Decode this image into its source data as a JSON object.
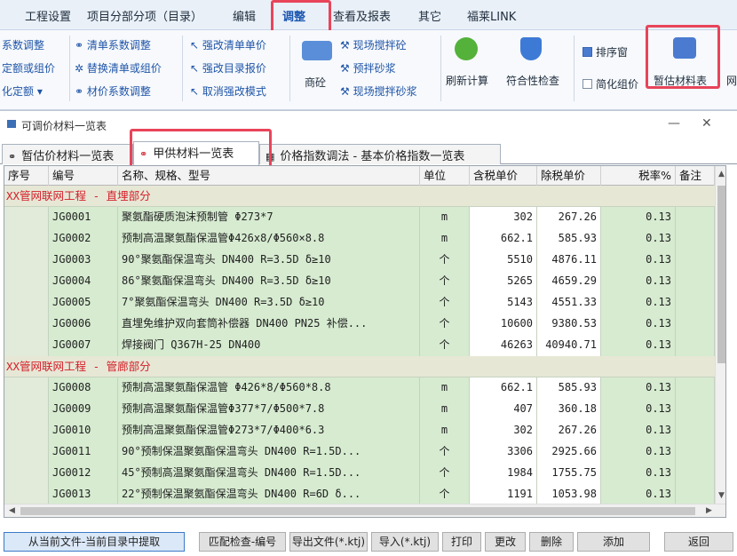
{
  "menu": {
    "items": [
      "工程设置",
      "项目分部分项（目录）",
      "编辑",
      "调整",
      "查看及报表",
      "其它",
      "福莱LINK"
    ]
  },
  "ribbon": {
    "left_col": [
      "系数调整",
      "定额或组价",
      "化定额 ▾"
    ],
    "col2": [
      "清单系数调整",
      "替换清单或组价",
      "材价系数调整"
    ],
    "col3": [
      "强改清单单价",
      "强改目录报价",
      "取消强改模式"
    ],
    "big1_label": "商砼",
    "col4": [
      "现场搅拌砼",
      "预拌砂浆",
      "现场搅拌砂浆"
    ],
    "refresh_label": "刷新计算",
    "check_label": "符合性检查",
    "col6": [
      "排序窗",
      "简化组价"
    ],
    "estimate_label": "暂估材料表",
    "cut_label": "网"
  },
  "dialog": {
    "title": "可调价材料一览表",
    "tabs": [
      "暂估价材料一览表",
      "甲供材料一览表",
      "价格指数调法 - 基本价格指数一览表"
    ]
  },
  "table": {
    "headers": [
      "序号",
      "编号",
      "名称、规格、型号",
      "单位",
      "含税单价",
      "除税单价",
      "税率%",
      "备注"
    ],
    "groups": [
      {
        "title": "XX管网联网工程 - 直埋部分",
        "rows": [
          {
            "code": "JG0001",
            "name": "聚氨酯硬质泡沫预制管 Φ273*7",
            "unit": "m",
            "tax": "302",
            "ntax": "267.26",
            "rate": "0.13"
          },
          {
            "code": "JG0002",
            "name": "预制高温聚氨酯保温管Φ426x8/Φ560×8.8",
            "unit": "m",
            "tax": "662.1",
            "ntax": "585.93",
            "rate": "0.13"
          },
          {
            "code": "JG0003",
            "name": "90°聚氨酯保温弯头 DN400 R=3.5D δ≥10",
            "unit": "个",
            "tax": "5510",
            "ntax": "4876.11",
            "rate": "0.13"
          },
          {
            "code": "JG0004",
            "name": "86°聚氨酯保温弯头 DN400 R=3.5D δ≥10",
            "unit": "个",
            "tax": "5265",
            "ntax": "4659.29",
            "rate": "0.13"
          },
          {
            "code": "JG0005",
            "name": "7°聚氨酯保温弯头 DN400 R=3.5D δ≥10",
            "unit": "个",
            "tax": "5143",
            "ntax": "4551.33",
            "rate": "0.13"
          },
          {
            "code": "JG0006",
            "name": "直埋免维护双向套筒补偿器 DN400 PN25 补偿...",
            "unit": "个",
            "tax": "10600",
            "ntax": "9380.53",
            "rate": "0.13"
          },
          {
            "code": "JG0007",
            "name": "焊接阀门 Q367H-25 DN400",
            "unit": "个",
            "tax": "46263",
            "ntax": "40940.71",
            "rate": "0.13"
          }
        ]
      },
      {
        "title": "XX管网联网工程 - 管廊部分",
        "rows": [
          {
            "code": "JG0008",
            "name": "预制高温聚氨酯保温管 Φ426*8/Φ560*8.8",
            "unit": "m",
            "tax": "662.1",
            "ntax": "585.93",
            "rate": "0.13"
          },
          {
            "code": "JG0009",
            "name": "预制高温聚氨酯保温管Φ377*7/Φ500*7.8",
            "unit": "m",
            "tax": "407",
            "ntax": "360.18",
            "rate": "0.13"
          },
          {
            "code": "JG0010",
            "name": "预制高温聚氨酯保温管Φ273*7/Φ400*6.3",
            "unit": "m",
            "tax": "302",
            "ntax": "267.26",
            "rate": "0.13"
          },
          {
            "code": "JG0011",
            "name": "90°预制保温聚氨酯保温弯头 DN400 R=1.5D...",
            "unit": "个",
            "tax": "3306",
            "ntax": "2925.66",
            "rate": "0.13"
          },
          {
            "code": "JG0012",
            "name": "45°预制高温聚氨酯保温弯头 DN400 R=1.5D...",
            "unit": "个",
            "tax": "1984",
            "ntax": "1755.75",
            "rate": "0.13"
          },
          {
            "code": "JG0013",
            "name": "22°预制保温聚氨酯保温弯头 DN400 R=6D δ...",
            "unit": "个",
            "tax": "1191",
            "ntax": "1053.98",
            "rate": "0.13"
          }
        ]
      }
    ]
  },
  "buttons": [
    "从当前文件-当前目录中提取",
    "匹配检查-编号",
    "导出文件(*.ktj)",
    "导入(*.ktj)",
    "打印",
    "更改",
    "删除",
    "添加",
    "返回"
  ],
  "colors": {
    "highlight": "#e8445a",
    "group_text": "#d4202a",
    "cell_green": "#d6ebd0"
  }
}
